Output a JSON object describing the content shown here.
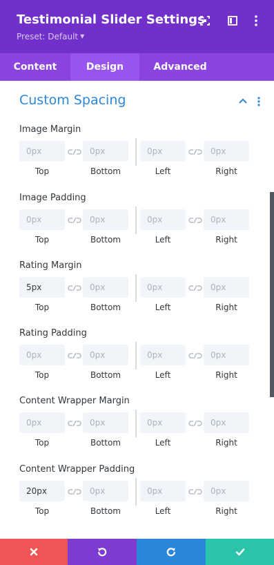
{
  "header": {
    "title": "Testimonial Slider Settings",
    "preset": "Preset: Default",
    "bg_color": "#7130c9"
  },
  "tabs": [
    {
      "label": "Content",
      "active": false
    },
    {
      "label": "Design",
      "active": true
    },
    {
      "label": "Advanced",
      "active": false
    }
  ],
  "section": {
    "title": "Custom Spacing",
    "expanded": true
  },
  "sides": [
    "Top",
    "Bottom",
    "Left",
    "Right"
  ],
  "placeholder": "0px",
  "groups": [
    {
      "label": "Image Margin",
      "values": [
        "",
        "",
        "",
        ""
      ]
    },
    {
      "label": "Image Padding",
      "values": [
        "",
        "",
        "",
        ""
      ]
    },
    {
      "label": "Rating Margin",
      "values": [
        "5px",
        "",
        "",
        ""
      ]
    },
    {
      "label": "Rating Padding",
      "values": [
        "",
        "",
        "",
        ""
      ]
    },
    {
      "label": "Content Wrapper Margin",
      "values": [
        "",
        "",
        "",
        ""
      ]
    },
    {
      "label": "Content Wrapper Padding",
      "values": [
        "20px",
        "",
        "",
        ""
      ]
    }
  ],
  "footer": {
    "buttons": [
      {
        "name": "discard-button",
        "icon": "close-icon",
        "color": "#ef5555"
      },
      {
        "name": "undo-button",
        "icon": "undo-icon",
        "color": "#7e3bd0"
      },
      {
        "name": "redo-button",
        "icon": "redo-icon",
        "color": "#2b87da"
      },
      {
        "name": "save-button",
        "icon": "checkmark-icon",
        "color": "#29c4a9"
      }
    ]
  }
}
